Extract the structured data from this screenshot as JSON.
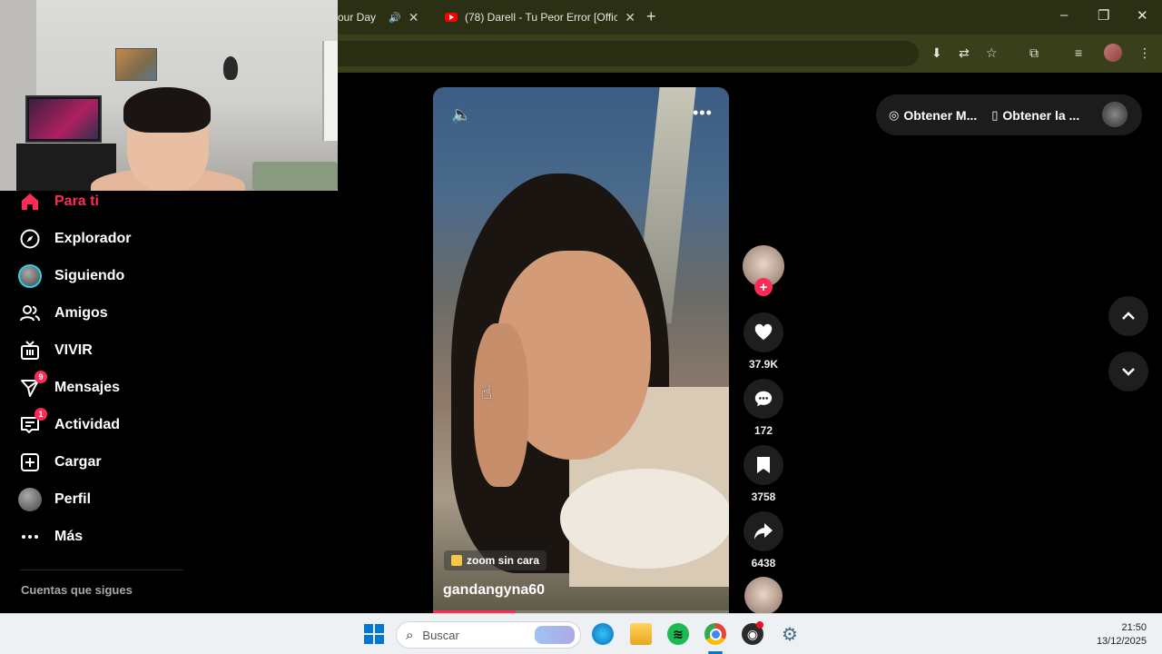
{
  "browser": {
    "tabs": [
      {
        "label": "our Day",
        "active": false
      },
      {
        "label": "(78) Darell - Tu Peor Error [Offic",
        "active": true
      }
    ],
    "new_tab_symbol": "+",
    "window_controls": [
      "–",
      "❐",
      "✕"
    ]
  },
  "sidebar": {
    "items": [
      {
        "label": "Para ti",
        "icon": "home-icon",
        "active": true
      },
      {
        "label": "Explorador",
        "icon": "compass-icon"
      },
      {
        "label": "Siguiendo",
        "icon": "following-avatar"
      },
      {
        "label": "Amigos",
        "icon": "friends-icon"
      },
      {
        "label": "VIVIR",
        "icon": "live-tv-icon"
      },
      {
        "label": "Mensajes",
        "icon": "messages-icon",
        "badge": "9"
      },
      {
        "label": "Actividad",
        "icon": "activity-icon",
        "badge": "1"
      },
      {
        "label": "Cargar",
        "icon": "upload-icon"
      },
      {
        "label": "Perfil",
        "icon": "profile-avatar"
      },
      {
        "label": "Más",
        "icon": "more-icon"
      }
    ],
    "following_title": "Cuentas que sigues"
  },
  "video": {
    "effect_label": "zoom sin cara",
    "username": "gandangyna60",
    "progress": 0.28
  },
  "actions": {
    "likes": "37.9K",
    "comments": "172",
    "saves": "3758",
    "shares": "6438"
  },
  "topbar": {
    "get_coins": "Obtener M...",
    "get_app": "Obtener la ..."
  },
  "taskbar": {
    "search_placeholder": "Buscar",
    "time": "21:50",
    "date": "13/12/2025"
  },
  "colors": {
    "accent": "#fe2c55",
    "following_ring": "#20d5ec",
    "browser_tabbar": "#2b2f13",
    "browser_toolbar": "#3a3f1b"
  }
}
